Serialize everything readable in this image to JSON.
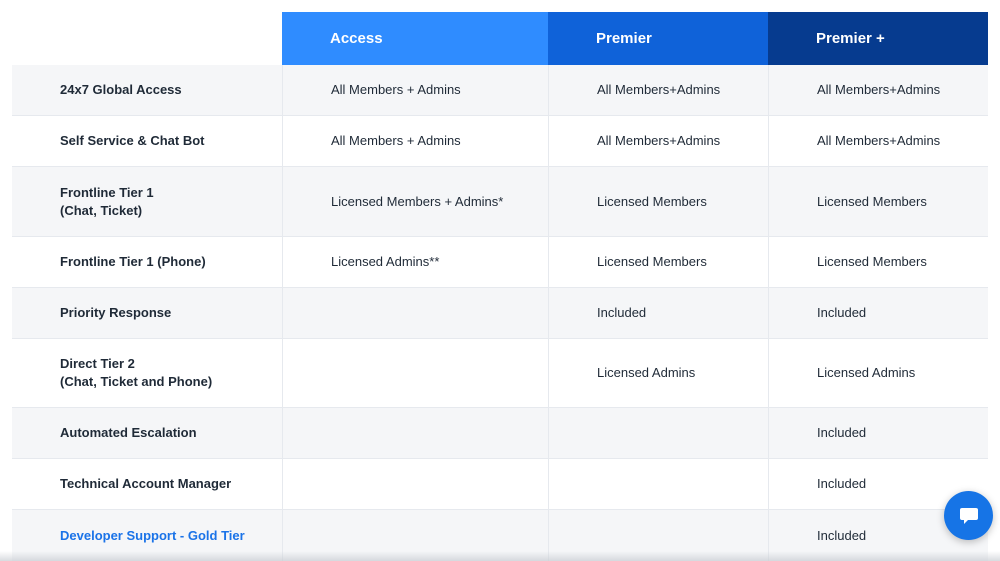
{
  "header": {
    "tiers": [
      "Access",
      "Premier",
      "Premier +"
    ]
  },
  "rows": [
    {
      "feature": "24x7 Global Access",
      "access": "All Members + Admins",
      "premier": "All Members+Admins",
      "premier_plus": "All Members+Admins"
    },
    {
      "feature": "Self Service & Chat Bot",
      "access": "All Members + Admins",
      "premier": "All Members+Admins",
      "premier_plus": "All Members+Admins"
    },
    {
      "feature": "Frontline Tier 1\n(Chat, Ticket)",
      "access": "Licensed Members + Admins*",
      "premier": "Licensed Members",
      "premier_plus": "Licensed Members"
    },
    {
      "feature": "Frontline Tier 1 (Phone)",
      "access": "Licensed Admins**",
      "premier": "Licensed Members",
      "premier_plus": "Licensed Members"
    },
    {
      "feature": "Priority Response",
      "access": "",
      "premier": "Included",
      "premier_plus": "Included"
    },
    {
      "feature": "Direct Tier 2\n(Chat, Ticket and Phone)",
      "access": "",
      "premier": "Licensed Admins",
      "premier_plus": "Licensed Admins"
    },
    {
      "feature": "Automated Escalation",
      "access": "",
      "premier": "",
      "premier_plus": "Included"
    },
    {
      "feature": "Technical Account Manager",
      "access": "",
      "premier": "",
      "premier_plus": "Included"
    },
    {
      "feature": "Developer Support - Gold Tier",
      "access": "",
      "premier": "",
      "premier_plus": "Included"
    }
  ],
  "chat_widget": {
    "icon": "chat-bubble-icon"
  }
}
